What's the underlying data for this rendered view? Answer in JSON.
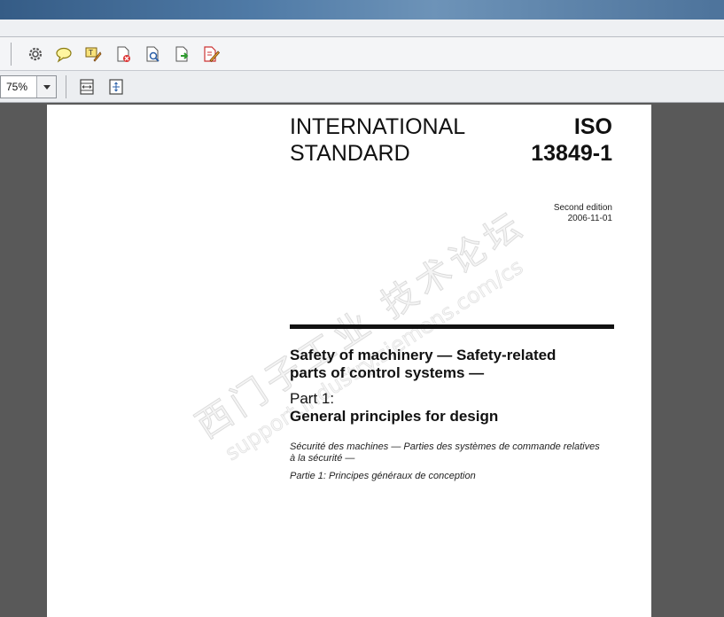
{
  "toolbar": {
    "icons": [
      "gear-icon",
      "comment-icon",
      "typewriter-icon",
      "delete-pages-icon",
      "search-icon",
      "export-icon",
      "edit-form-icon"
    ],
    "zoom": "75%"
  },
  "document": {
    "header_left": [
      "INTERNATIONAL",
      "STANDARD"
    ],
    "header_right": [
      "ISO",
      "13849-1"
    ],
    "edition": "Second edition",
    "date": "2006-11-01",
    "title_en_line1": "Safety of machinery — Safety-related",
    "title_en_line2": "parts of control systems —",
    "part_label": "Part 1:",
    "part_title": "General principles for design",
    "title_fr_line1": "Sécurité des machines — Parties des systèmes de commande relatives",
    "title_fr_line2": "à la sécurité —",
    "part_fr": "Partie 1: Principes généraux de conception"
  },
  "watermark": {
    "line1": "西门子工业  技术论坛",
    "line2": "support.industry.siemens.com/cs"
  }
}
